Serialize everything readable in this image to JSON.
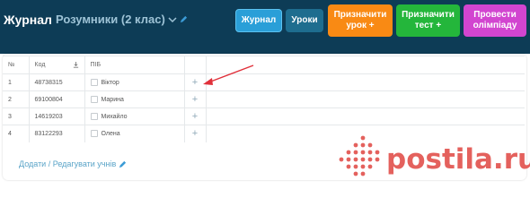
{
  "header": {
    "title": "Журнал",
    "class_select": "Розумники (2 клас)",
    "buttons": {
      "journal": "Журнал",
      "lessons": "Уроки",
      "assign_lesson_1": "Призначити",
      "assign_lesson_2": "урок +",
      "assign_test_1": "Призначити",
      "assign_test_2": "тест +",
      "olympiad_1": "Провести",
      "olympiad_2": "олімпіаду"
    }
  },
  "table": {
    "columns": {
      "num": "№",
      "code": "Код",
      "name": "ПІБ"
    },
    "rows": [
      {
        "num": "1",
        "code": "48738315",
        "name": "Віктор"
      },
      {
        "num": "2",
        "code": "69100804",
        "name": "Марина"
      },
      {
        "num": "3",
        "code": "14619203",
        "name": "Михайло"
      },
      {
        "num": "4",
        "code": "83122293",
        "name": "Олена"
      }
    ]
  },
  "footer": {
    "edit_link": "Додати / Редагувати учнів"
  },
  "watermark": {
    "text": "postila.ru"
  },
  "colors": {
    "header_bg": "#0d3c56",
    "journal_btn": "#2a9fd8",
    "lessons_btn": "#1e6d8f",
    "assign_lesson_btn": "#f98a14",
    "assign_test_btn": "#24b63b",
    "olympiad_btn": "#d245d0",
    "annotation_arrow": "#e0303a",
    "watermark": "#e2514c"
  },
  "icons": [
    "pencil-icon",
    "chevron-down-icon",
    "download-icon",
    "plus-icon",
    "arrow-annotation"
  ]
}
